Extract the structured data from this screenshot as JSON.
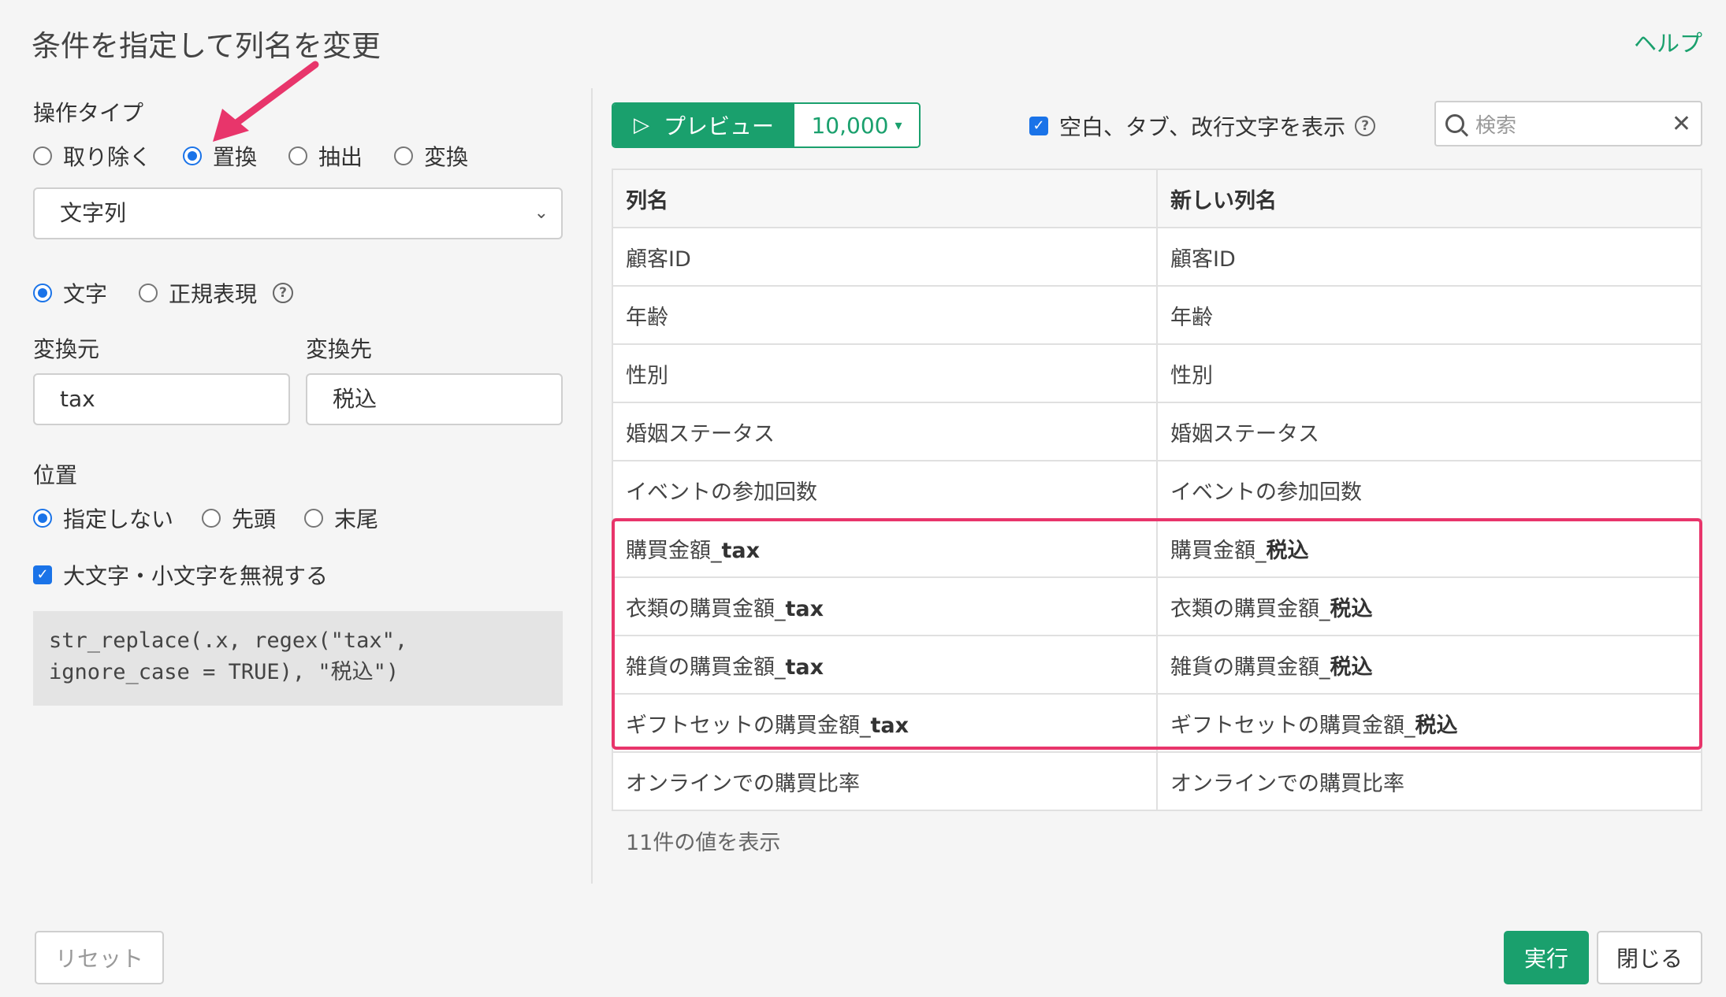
{
  "dialog": {
    "title": "条件を指定して列名を変更",
    "help_label": "ヘルプ"
  },
  "operation": {
    "label": "操作タイプ",
    "options": [
      "取り除く",
      "置換",
      "抽出",
      "変換"
    ],
    "selected": "置換"
  },
  "type_select": {
    "value": "文字列"
  },
  "match_mode": {
    "options": [
      "文字",
      "正規表現"
    ],
    "selected": "文字"
  },
  "replace": {
    "from_label": "変換元",
    "from_value": "tax",
    "to_label": "変換先",
    "to_value": "税込"
  },
  "position": {
    "label": "位置",
    "options": [
      "指定しない",
      "先頭",
      "末尾"
    ],
    "selected": "指定しない"
  },
  "ignore_case": {
    "label": "大文字・小文字を無視する",
    "checked": true
  },
  "code": "str_replace(.x, regex(\"tax\",\nignore_case = TRUE), \"税込\")",
  "toolbar": {
    "preview_label": "プレビュー",
    "row_count": "10,000",
    "show_whitespace_label": "空白、タブ、改行文字を表示",
    "show_whitespace_checked": true,
    "search_placeholder": "検索"
  },
  "table": {
    "headers": [
      "列名",
      "新しい列名"
    ],
    "rows": [
      {
        "old": "顧客ID",
        "old_match": "",
        "new": "顧客ID",
        "new_match": ""
      },
      {
        "old": "年齢",
        "old_match": "",
        "new": "年齢",
        "new_match": ""
      },
      {
        "old": "性別",
        "old_match": "",
        "new": "性別",
        "new_match": ""
      },
      {
        "old": "婚姻ステータス",
        "old_match": "",
        "new": "婚姻ステータス",
        "new_match": ""
      },
      {
        "old": "イベントの参加回数",
        "old_match": "",
        "new": "イベントの参加回数",
        "new_match": ""
      },
      {
        "old": "購買金額_",
        "old_match": "tax",
        "new": "購買金額_",
        "new_match": "税込"
      },
      {
        "old": "衣類の購買金額_",
        "old_match": "tax",
        "new": "衣類の購買金額_",
        "new_match": "税込"
      },
      {
        "old": "雑貨の購買金額_",
        "old_match": "tax",
        "new": "雑貨の購買金額_",
        "new_match": "税込"
      },
      {
        "old": "ギフトセットの購買金額_",
        "old_match": "tax",
        "new": "ギフトセットの購買金額_",
        "new_match": "税込"
      },
      {
        "old": "オンラインでの購買比率",
        "old_match": "",
        "new": "オンラインでの購買比率",
        "new_match": ""
      }
    ],
    "count_text": "11件の値を表示"
  },
  "footer": {
    "reset_label": "リセット",
    "run_label": "実行",
    "close_label": "閉じる"
  },
  "colors": {
    "accent_green": "#1aa06d",
    "radio_blue": "#1a73e8",
    "highlight_pink": "#e8356b"
  }
}
